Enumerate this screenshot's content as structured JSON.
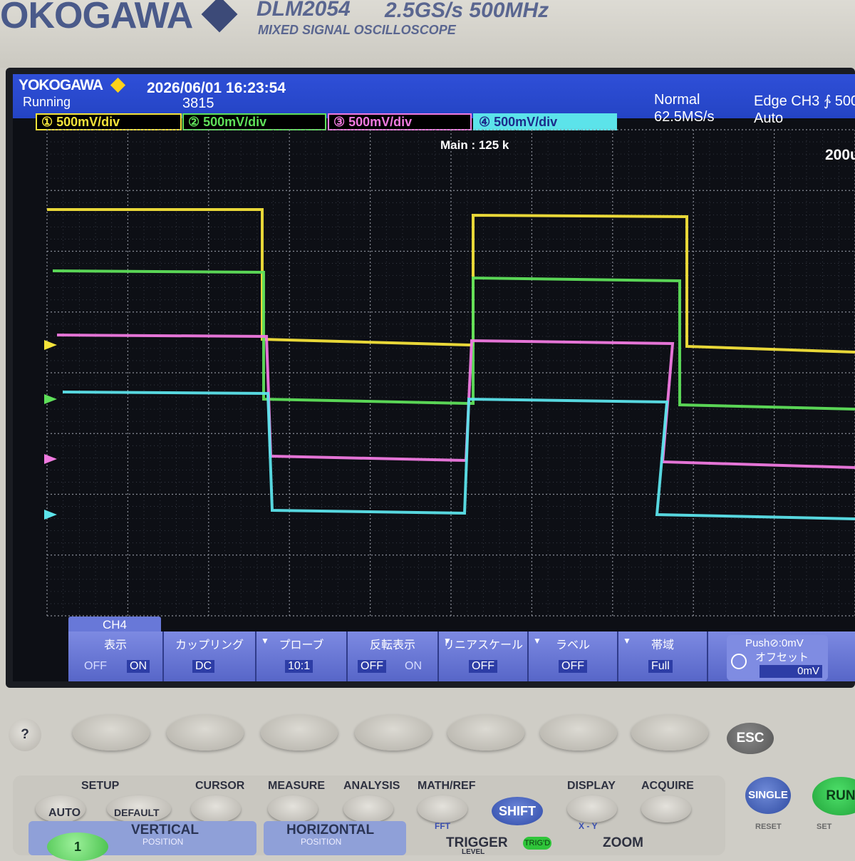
{
  "instrument": {
    "brand": "OKOGAWA",
    "model": "DLM2054",
    "spec": "2.5GS/s 500MHz",
    "subtitle": "MIXED SIGNAL OSCILLOSCOPE"
  },
  "screen": {
    "logo": "YOKOGAWA",
    "run_state": "Running",
    "datetime": "2026/06/01 16:23:54",
    "record_count": "3815",
    "acq_mode": "Normal",
    "sample_rate": "62.5MS/s",
    "trigger_source": "Edge CH3 ∱ 500",
    "trigger_mode": "Auto",
    "main_record": "Main : 125 k",
    "timebase": "200u",
    "channels": [
      {
        "label": "① 500mV/div",
        "color": "#f4e33a",
        "text_color": "#f4e33a",
        "bg": "#000000"
      },
      {
        "label": "② 500mV/div",
        "color": "#5fe05a",
        "text_color": "#5fe05a",
        "bg": "#000000"
      },
      {
        "label": "③ 500mV/div",
        "color": "#f07ae0",
        "text_color": "#f07ae0",
        "bg": "#000000"
      },
      {
        "label": "④ 500mV/div",
        "color": "#5ce3ea",
        "text_color": "#1b2a8a",
        "bg": "#5ce3ea"
      }
    ]
  },
  "menu": {
    "tab": "CH4",
    "keys": [
      {
        "title": "表示",
        "values": [
          "OFF",
          "ON"
        ],
        "selected": 1
      },
      {
        "title": "カップリング",
        "values": [
          "DC"
        ],
        "selected": 0
      },
      {
        "title": "プローブ",
        "values": [
          "10:1"
        ],
        "selected": 0
      },
      {
        "title": "反転表示",
        "values": [
          "OFF",
          "ON"
        ],
        "selected": 0
      },
      {
        "title": "リニアスケール",
        "values": [
          "OFF"
        ],
        "selected": 0
      },
      {
        "title": "ラベル",
        "values": [
          "OFF"
        ],
        "selected": 0
      },
      {
        "title": "帯域",
        "values": [
          "Full"
        ],
        "selected": 0
      }
    ],
    "push_title": "Push⊘:0mV",
    "offset_label": "オフセット",
    "offset_value": "0mV"
  },
  "panel": {
    "help": "?",
    "esc": "ESC",
    "setup": "SETUP",
    "auto": "AUTO",
    "default": "DEFAULT",
    "cursor": "CURSOR",
    "measure": "MEASURE",
    "analysis": "ANALYSIS",
    "math_ref": "MATH/REF",
    "fft": "FFT",
    "shift": "SHIFT",
    "display": "DISPLAY",
    "xy": "X - Y",
    "acquire": "ACQUIRE",
    "single": "SINGLE",
    "run": "RUN",
    "vertical": "VERTICAL",
    "vertical_position": "POSITION",
    "horizontal": "HORIZONTAL",
    "horizontal_position": "POSITION",
    "trigger": "TRIGGER",
    "trigger_level": "LEVEL",
    "trigd": "TRIG'D",
    "zoom": "ZOOM",
    "ch1": "1",
    "reset": "RESET",
    "set": "SET"
  }
}
